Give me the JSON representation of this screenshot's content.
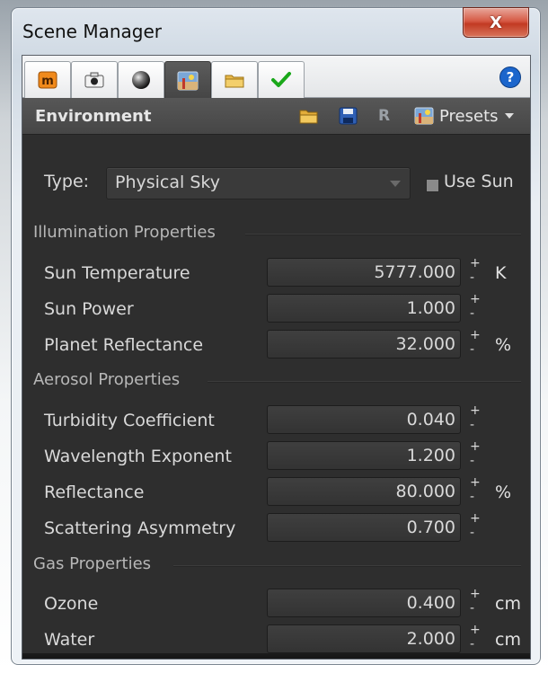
{
  "window": {
    "title": "Scene Manager",
    "close_label": "X"
  },
  "tabs": [
    {
      "name": "material-tab",
      "icon": "material-icon"
    },
    {
      "name": "camera-tab",
      "icon": "camera-icon"
    },
    {
      "name": "sphere-tab",
      "icon": "sphere-icon"
    },
    {
      "name": "environment-tab",
      "icon": "environment-icon",
      "active": true
    },
    {
      "name": "folder-tab",
      "icon": "folder-icon"
    },
    {
      "name": "check-tab",
      "icon": "checkmark-icon"
    }
  ],
  "help": {
    "label": "?"
  },
  "toolbar": {
    "section": "Environment",
    "r_label": "R",
    "presets_label": "Presets"
  },
  "type_row": {
    "label": "Type:",
    "value": "Physical Sky",
    "use_sun_label": "Use Sun"
  },
  "illumination": {
    "title": "Illumination Properties",
    "rows": [
      {
        "label": "Sun Temperature",
        "value": "5777.000",
        "unit": "K"
      },
      {
        "label": "Sun Power",
        "value": "1.000",
        "unit": ""
      },
      {
        "label": "Planet Reflectance",
        "value": "32.000",
        "unit": "%"
      }
    ]
  },
  "aerosol": {
    "title": "Aerosol Properties",
    "rows": [
      {
        "label": "Turbidity Coefficient",
        "value": "0.040",
        "unit": ""
      },
      {
        "label": "Wavelength Exponent",
        "value": "1.200",
        "unit": ""
      },
      {
        "label": "Reflectance",
        "value": "80.000",
        "unit": "%"
      },
      {
        "label": "Scattering Asymmetry",
        "value": "0.700",
        "unit": ""
      }
    ]
  },
  "gas": {
    "title": "Gas Properties",
    "rows": [
      {
        "label": "Ozone",
        "value": "0.400",
        "unit": "cm"
      },
      {
        "label": "Water",
        "value": "2.000",
        "unit": "cm"
      }
    ]
  },
  "spinner": {
    "plus": "+",
    "minus": "-"
  },
  "colors": {
    "panel_bg": "#2e2e2e",
    "toolbar_bg": "#4e4e4e",
    "help_blue": "#1c66cc",
    "check_green": "#1aa81a",
    "close_red": "#c23a23"
  }
}
